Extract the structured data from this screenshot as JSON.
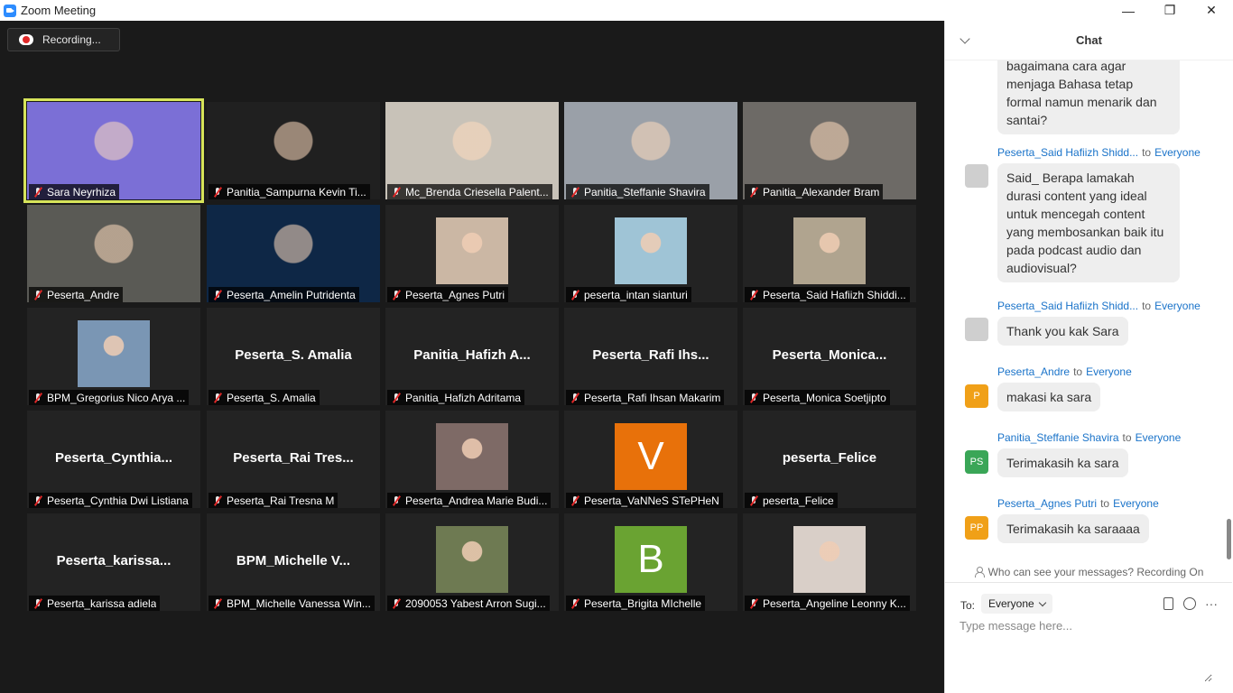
{
  "window": {
    "title": "Zoom Meeting",
    "controls": [
      "—",
      "❐",
      "✕"
    ]
  },
  "recording": {
    "label": "Recording..."
  },
  "participants": [
    {
      "name": "Sara Neyrhiza",
      "kind": "video",
      "bg": "#7b6fd6",
      "active": true
    },
    {
      "name": "Panitia_Sampurna Kevin Ti...",
      "kind": "video",
      "bg": "#202020",
      "speaking": true
    },
    {
      "name": "Mc_Brenda Criesella Palent...",
      "kind": "video",
      "bg": "#c8c2b8"
    },
    {
      "name": "Panitia_Steffanie Shavira",
      "kind": "video",
      "bg": "#9aa0a8"
    },
    {
      "name": "Panitia_Alexander Bram",
      "kind": "video",
      "bg": "#6d6a66"
    },
    {
      "name": "Peserta_Andre",
      "kind": "video",
      "bg": "#5a5a55"
    },
    {
      "name": "Peserta_Amelin Putridenta",
      "kind": "video",
      "bg": "#0e2746"
    },
    {
      "name": "Peserta_Agnes Putri",
      "kind": "photo",
      "bg": "#cbb7a4"
    },
    {
      "name": "peserta_intan sianturi",
      "kind": "photo",
      "bg": "#9fc4d6"
    },
    {
      "name": "Peserta_Said Hafiizh Shiddi...",
      "kind": "photo",
      "bg": "#b0a48f"
    },
    {
      "name": "BPM_Gregorius Nico Arya ...",
      "kind": "photo",
      "bg": "#7a96b4"
    },
    {
      "name": "Peserta_S. Amalia",
      "kind": "text",
      "display": "Peserta_S. Amalia"
    },
    {
      "name": "Panitia_Hafizh Adritama",
      "kind": "text",
      "display": "Panitia_Hafizh  A..."
    },
    {
      "name": "Peserta_Rafi Ihsan Makarim",
      "kind": "text",
      "display": "Peserta_Rafi  Ihs..."
    },
    {
      "name": "Peserta_Monica Soetjipto",
      "kind": "text",
      "display": "Peserta_Monica..."
    },
    {
      "name": "Peserta_Cynthia Dwi Listiana",
      "kind": "text",
      "display": "Peserta_Cynthia..."
    },
    {
      "name": "Peserta_Rai Tresna M",
      "kind": "text",
      "display": "Peserta_Rai  Tres..."
    },
    {
      "name": "Peserta_Andrea Marie Budi...",
      "kind": "photo",
      "bg": "#7e6a66"
    },
    {
      "name": "Peserta_VaNNeS STePHeN",
      "kind": "letter",
      "letter": "V",
      "bg": "#e8710a"
    },
    {
      "name": "peserta_Felice",
      "kind": "text",
      "display": "peserta_Felice"
    },
    {
      "name": "Peserta_karissa adiela",
      "kind": "text",
      "display": "Peserta_karissa..."
    },
    {
      "name": "BPM_Michelle Vanessa Win...",
      "kind": "text",
      "display": "BPM_Michelle  V..."
    },
    {
      "name": "2090053 Yabest Arron Sugi...",
      "kind": "photo",
      "bg": "#6e7a52"
    },
    {
      "name": "Peserta_Brigita MIchelle",
      "kind": "letter",
      "letter": "B",
      "bg": "#6aa332"
    },
    {
      "name": "Peserta_Angeline Leonny K...",
      "kind": "photo",
      "bg": "#d9cfc8"
    }
  ],
  "chat": {
    "title": "Chat",
    "messages": [
      {
        "sender": "",
        "recipient": "",
        "text": "bagaimana cara agar menjaga Bahasa tetap formal namun menarik dan santai?",
        "avatar": "",
        "avatar_color": ""
      },
      {
        "sender": "Peserta_Said Hafiizh Shidd...",
        "recipient": "Everyone",
        "text": "Said_ Berapa lamakah durasi content yang ideal untuk mencegah content yang membosankan baik itu pada podcast audio dan audiovisual?",
        "avatar": "",
        "avatar_color": "#cfcfcf"
      },
      {
        "sender": "Peserta_Said Hafiizh Shidd...",
        "recipient": "Everyone",
        "text": "Thank you kak Sara",
        "avatar": "",
        "avatar_color": "#cfcfcf"
      },
      {
        "sender": "Peserta_Andre",
        "recipient": "Everyone",
        "text": "makasi ka sara",
        "avatar": "P",
        "avatar_color": "#f0a018"
      },
      {
        "sender": "Panitia_Steffanie Shavira",
        "recipient": "Everyone",
        "text": "Terimakasih ka sara",
        "avatar": "PS",
        "avatar_color": "#3aa657"
      },
      {
        "sender": "Peserta_Agnes Putri",
        "recipient": "Everyone",
        "text": "Terimakasih ka saraaaa",
        "avatar": "PP",
        "avatar_color": "#f0a018"
      }
    ],
    "to_word": "to",
    "privacy_note": "Who can see your messages? Recording On",
    "to_label": "To:",
    "recipient_select": "Everyone",
    "input_placeholder": "Type message here..."
  }
}
